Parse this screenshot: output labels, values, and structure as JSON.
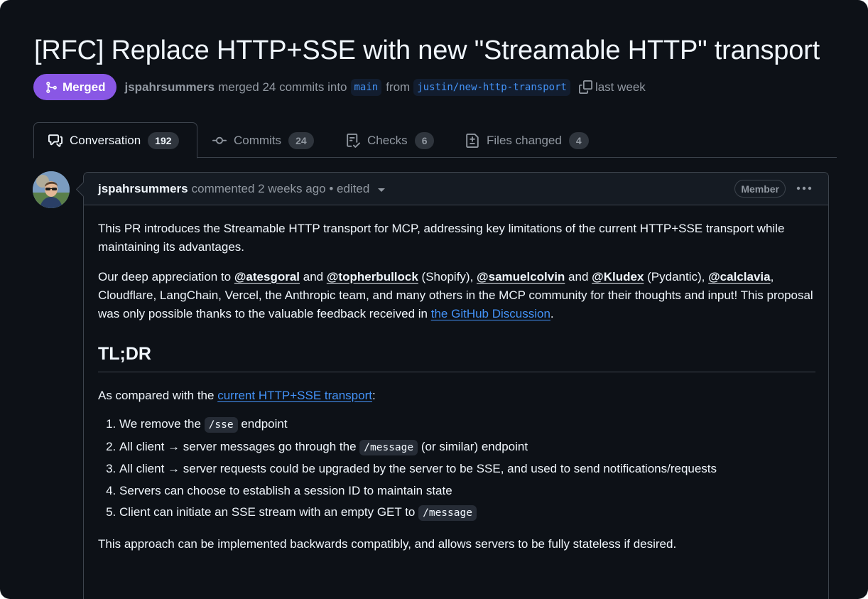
{
  "pr": {
    "title": "[RFC] Replace HTTP+SSE with new \"Streamable HTTP\" transport",
    "state_label": "Merged",
    "author": "jspahrsummers",
    "merged_text": "merged 24 commits into",
    "base_branch": "main",
    "from_text": "from",
    "head_branch": "justin/new-http-transport",
    "time": "last week"
  },
  "tabs": [
    {
      "label": "Conversation",
      "count": "192",
      "icon": "comment-discussion-icon"
    },
    {
      "label": "Commits",
      "count": "24",
      "icon": "git-commit-icon"
    },
    {
      "label": "Checks",
      "count": "6",
      "icon": "checklist-icon"
    },
    {
      "label": "Files changed",
      "count": "4",
      "icon": "file-diff-icon"
    }
  ],
  "comment": {
    "author": "jspahrsummers",
    "meta": "commented 2 weeks ago • edited",
    "role_badge": "Member",
    "intro": "This PR introduces the Streamable HTTP transport for MCP, addressing key limitations of the current HTTP+SSE transport while maintaining its advantages.",
    "thanks": {
      "t1": "Our deep appreciation to ",
      "m1": "@atesgoral",
      "t2": " and ",
      "m2": "@topherbullock",
      "t3": " (Shopify), ",
      "m3": "@samuelcolvin",
      "t4": " and ",
      "m4": "@Kludex",
      "t5": " (Pydantic), ",
      "m5": "@calclavia",
      "t6": ", Cloudflare, LangChain, Vercel, the Anthropic team, and many others in the MCP community for their thoughts and input! This proposal was only possible thanks to the valuable feedback received in ",
      "link": "the GitHub Discussion",
      "t7": "."
    },
    "heading": "TL;DR",
    "compare": {
      "t1": "As compared with the ",
      "link": "current HTTP+SSE transport",
      "t2": ":"
    },
    "list": [
      {
        "pre": "We remove the ",
        "code": "/sse",
        "post": " endpoint"
      },
      {
        "pre": "All client → server messages go through the ",
        "code": "/message",
        "post": " (or similar) endpoint"
      },
      {
        "pre": "All client → server requests could be upgraded by the server to be SSE, and used to send notifications/requests",
        "code": "",
        "post": ""
      },
      {
        "pre": "Servers can choose to establish a session ID to maintain state",
        "code": "",
        "post": ""
      },
      {
        "pre": "Client can initiate an SSE stream with an empty GET to ",
        "code": "/message",
        "post": ""
      }
    ],
    "closing": "This approach can be implemented backwards compatibly, and allows servers to be fully stateless if desired."
  }
}
